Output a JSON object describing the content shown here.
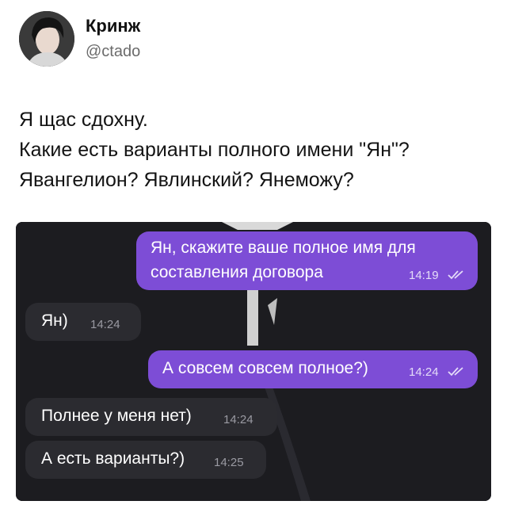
{
  "post": {
    "author_name": "Кринж",
    "author_handle": "@ctado",
    "text_lines": [
      "Я щас сдохну.",
      "Какие есть варианты полного имени \"Ян\"?",
      "Явангелион? Явлинский? Янеможу?"
    ]
  },
  "chat": {
    "messages": [
      {
        "direction": "outgoing",
        "lines": [
          "Ян, скажите ваше полное имя для",
          "составления договора"
        ],
        "time": "14:19",
        "read_icon": "double-check-icon"
      },
      {
        "direction": "incoming",
        "lines": [
          "Ян)"
        ],
        "time": "14:24"
      },
      {
        "direction": "outgoing",
        "lines": [
          "А совсем совсем полное?)"
        ],
        "time": "14:24",
        "read_icon": "double-check-icon"
      },
      {
        "direction": "incoming",
        "lines": [
          "Полнее у меня нет)"
        ],
        "time": "14:24"
      },
      {
        "direction": "incoming",
        "lines": [
          "А есть варианты?)"
        ],
        "time": "14:25"
      }
    ]
  },
  "colors": {
    "outgoing_bubble": "#7d4dd6",
    "incoming_bubble": "#2b2b30",
    "chat_background": "#1c1c20"
  }
}
